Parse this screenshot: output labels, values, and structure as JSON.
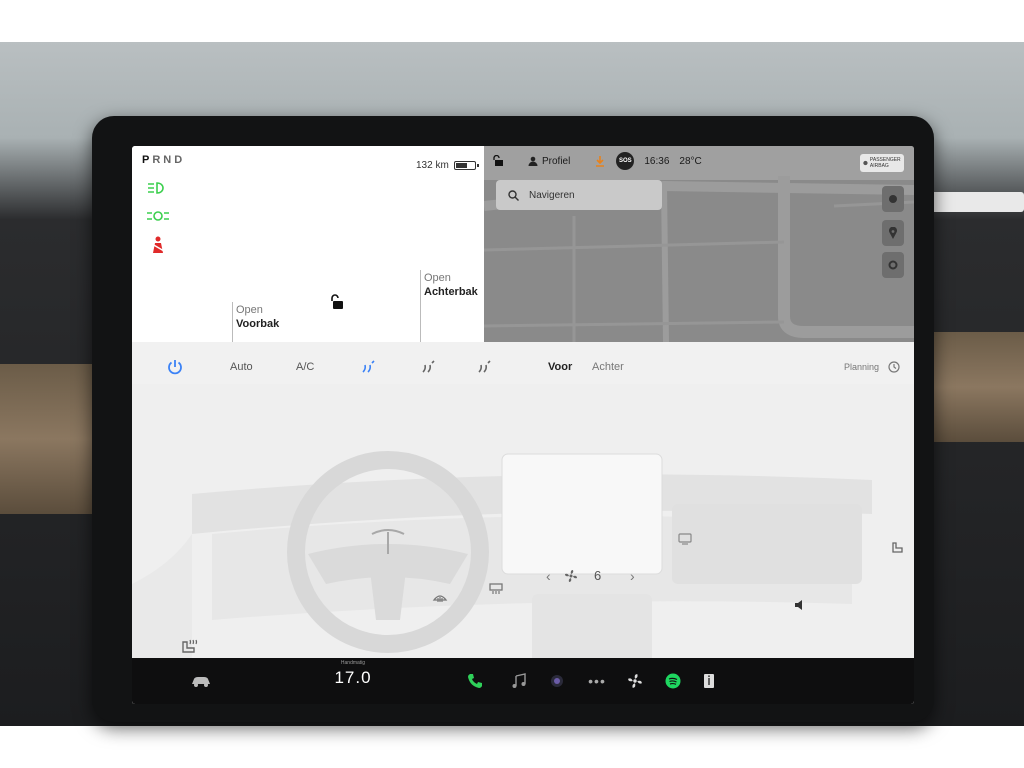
{
  "vehicle": {
    "gears": [
      "P",
      "R",
      "N",
      "D"
    ],
    "active_gear": "P",
    "range": "132 km",
    "battery_level": 0.55,
    "frunk": {
      "status": "Open",
      "name": "Voorbak"
    },
    "trunk": {
      "status": "Open",
      "name": "Achterbak"
    },
    "indicator_icons": [
      "headlight-icon",
      "parking-light-icon",
      "seatbelt-warning-icon"
    ],
    "indicator_colors": {
      "lights": "#3ccf4e",
      "warning": "#e02a2a"
    }
  },
  "status_bar": {
    "profile_label": "Profiel",
    "sos_label": "SOS",
    "time": "16:36",
    "temperature": "28°C",
    "passenger_airbag": "PASSENGER AIRBAG"
  },
  "map": {
    "search_placeholder": "Navigeren"
  },
  "climate": {
    "auto_label": "Auto",
    "ac_label": "A/C",
    "front_label": "Voor",
    "rear_label": "Achter",
    "planning_label": "Planning",
    "fan_speed": "6",
    "accent_color": "#3b82f6"
  },
  "taskbar": {
    "temp_mode": "Handmatig",
    "temp_value": "17.0"
  }
}
